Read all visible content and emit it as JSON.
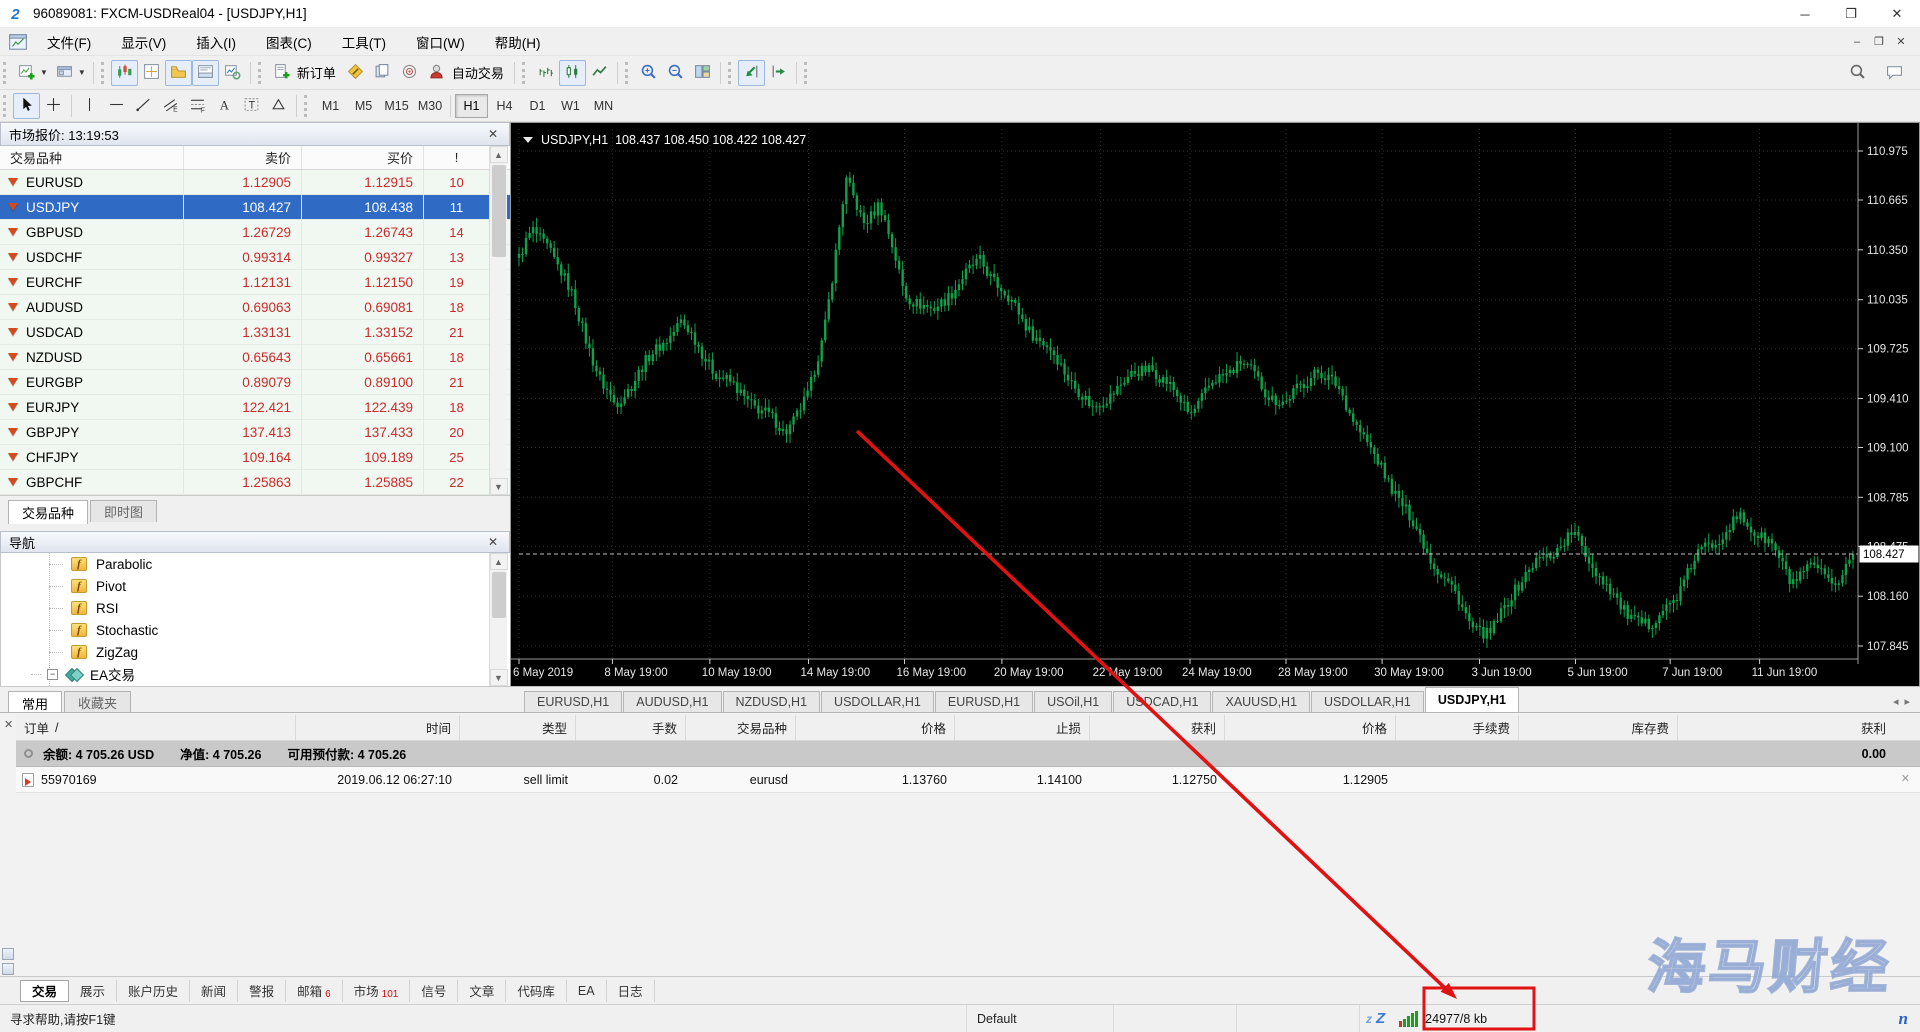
{
  "window": {
    "title": "96089081: FXCM-USDReal04 - [USDJPY,H1]"
  },
  "menu": {
    "items": [
      "文件(F)",
      "显示(V)",
      "插入(I)",
      "图表(C)",
      "工具(T)",
      "窗口(W)",
      "帮助(H)"
    ]
  },
  "toolbars": {
    "new_order_label": "新订单",
    "auto_trading_label": "自动交易",
    "main_groups": [
      [
        "new-chart",
        "profiles"
      ],
      [
        "market-watch",
        "data-window",
        "navigator",
        "terminal",
        "tester"
      ],
      [
        "new-order",
        "metaeditor",
        "docs",
        "optimization",
        "autotrading"
      ],
      [
        "bars-chart",
        "candles-chart",
        "line-chart"
      ],
      [
        "zoom-in",
        "zoom-out",
        "tile-windows"
      ],
      [
        "auto-scroll",
        "chart-shift"
      ]
    ],
    "right_icons": [
      "search",
      "chat"
    ],
    "pressed": [
      "market-watch",
      "navigator",
      "terminal",
      "candles-chart",
      "auto-scroll"
    ],
    "draw_icons": [
      "cursor",
      "crosshair",
      "sep",
      "vertical-line",
      "horizontal-line",
      "trendline",
      "channel",
      "fibonacci",
      "text",
      "label",
      "shapes"
    ],
    "timeframes": {
      "items": [
        "M1",
        "M5",
        "M15",
        "M30",
        "H1",
        "H4",
        "D1",
        "W1",
        "MN"
      ],
      "active": "H1"
    }
  },
  "market_watch": {
    "title": "市场报价: 13:19:53",
    "columns": [
      "交易品种",
      "卖价",
      "买价",
      "!"
    ],
    "rows": [
      [
        "EURUSD",
        "1.12905",
        "1.12915",
        "10"
      ],
      [
        "USDJPY",
        "108.427",
        "108.438",
        "11"
      ],
      [
        "GBPUSD",
        "1.26729",
        "1.26743",
        "14"
      ],
      [
        "USDCHF",
        "0.99314",
        "0.99327",
        "13"
      ],
      [
        "EURCHF",
        "1.12131",
        "1.12150",
        "19"
      ],
      [
        "AUDUSD",
        "0.69063",
        "0.69081",
        "18"
      ],
      [
        "USDCAD",
        "1.33131",
        "1.33152",
        "21"
      ],
      [
        "NZDUSD",
        "0.65643",
        "0.65661",
        "18"
      ],
      [
        "EURGBP",
        "0.89079",
        "0.89100",
        "21"
      ],
      [
        "EURJPY",
        "122.421",
        "122.439",
        "18"
      ],
      [
        "GBPJPY",
        "137.413",
        "137.433",
        "20"
      ],
      [
        "CHFJPY",
        "109.164",
        "109.189",
        "25"
      ],
      [
        "GBPCHF",
        "1.25863",
        "1.25885",
        "22"
      ]
    ],
    "selected_symbol": "USDJPY",
    "tabs": [
      "交易品种",
      "即时图"
    ],
    "active_tab": "交易品种"
  },
  "navigator": {
    "title": "导航",
    "items": [
      "Parabolic",
      "Pivot",
      "RSI",
      "Stochastic",
      "ZigZag",
      "EA交易"
    ],
    "tabs": [
      "常用",
      "收藏夹"
    ],
    "active_tab": "常用"
  },
  "chart_tabs": {
    "items": [
      "EURUSD,H1",
      "AUDUSD,H1",
      "NZDUSD,H1",
      "USDOLLAR,H1",
      "EURUSD,H1",
      "USOil,H1",
      "USDCAD,H1",
      "XAUUSD,H1",
      "USDOLLAR,H1",
      "USDJPY,H1"
    ],
    "active": "USDJPY,H1"
  },
  "chart_data": {
    "type": "candlestick",
    "symbol": "USDJPY",
    "timeframe": "H1",
    "legend": {
      "symbol": "USDJPY,H1",
      "open": "108.437",
      "high": "108.450",
      "low": "108.422",
      "close": "108.427"
    },
    "current_price": 108.427,
    "y_ticks": [
      110.975,
      110.665,
      110.35,
      110.035,
      109.725,
      109.41,
      109.1,
      108.785,
      108.475,
      108.16,
      107.845
    ],
    "ylim": [
      107.72,
      111.1
    ],
    "x_labels": [
      "6 May 2019",
      "8 May 19:00",
      "10 May 19:00",
      "14 May 19:00",
      "16 May 19:00",
      "20 May 19:00",
      "22 May 19:00",
      "24 May 19:00",
      "28 May 19:00",
      "30 May 19:00",
      "3 Jun 19:00",
      "5 Jun 19:00",
      "7 Jun 19:00",
      "11 Jun 19:00"
    ],
    "x_tick_fractions": [
      0.0,
      0.07,
      0.143,
      0.217,
      0.289,
      0.362,
      0.436,
      0.503,
      0.575,
      0.647,
      0.72,
      0.792,
      0.863,
      0.93
    ],
    "candle_count": 380,
    "price_path_anchors": [
      [
        0.0,
        110.3
      ],
      [
        0.01,
        110.46
      ],
      [
        0.022,
        110.38
      ],
      [
        0.04,
        110.05
      ],
      [
        0.062,
        109.5
      ],
      [
        0.072,
        109.36
      ],
      [
        0.09,
        109.58
      ],
      [
        0.121,
        109.9
      ],
      [
        0.15,
        109.55
      ],
      [
        0.17,
        109.42
      ],
      [
        0.199,
        109.2
      ],
      [
        0.217,
        109.42
      ],
      [
        0.228,
        109.8
      ],
      [
        0.245,
        110.78
      ],
      [
        0.258,
        110.52
      ],
      [
        0.27,
        110.65
      ],
      [
        0.289,
        110.08
      ],
      [
        0.31,
        109.95
      ],
      [
        0.33,
        110.15
      ],
      [
        0.346,
        110.28
      ],
      [
        0.362,
        110.1
      ],
      [
        0.38,
        109.88
      ],
      [
        0.399,
        109.7
      ],
      [
        0.42,
        109.46
      ],
      [
        0.43,
        109.33
      ],
      [
        0.45,
        109.5
      ],
      [
        0.474,
        109.62
      ],
      [
        0.503,
        109.32
      ],
      [
        0.52,
        109.5
      ],
      [
        0.541,
        109.65
      ],
      [
        0.56,
        109.45
      ],
      [
        0.575,
        109.38
      ],
      [
        0.598,
        109.6
      ],
      [
        0.616,
        109.45
      ],
      [
        0.64,
        109.05
      ],
      [
        0.655,
        108.85
      ],
      [
        0.684,
        108.4
      ],
      [
        0.703,
        108.15
      ],
      [
        0.714,
        107.98
      ],
      [
        0.728,
        107.9
      ],
      [
        0.745,
        108.2
      ],
      [
        0.762,
        108.36
      ],
      [
        0.79,
        108.55
      ],
      [
        0.81,
        108.3
      ],
      [
        0.826,
        108.08
      ],
      [
        0.848,
        107.96
      ],
      [
        0.87,
        108.2
      ],
      [
        0.886,
        108.45
      ],
      [
        0.916,
        108.65
      ],
      [
        0.937,
        108.5
      ],
      [
        0.953,
        108.26
      ],
      [
        0.97,
        108.34
      ],
      [
        0.985,
        108.22
      ],
      [
        1.0,
        108.43
      ]
    ],
    "grid": true,
    "legend_position": "top-left",
    "colors": {
      "background": "#000000",
      "grid": "#2e2e2e",
      "candle": "#0fa24a",
      "axis_text": "#e8e8e8",
      "price_tag_bg": "#ffffff",
      "price_tag_text": "#000000",
      "current_price_line": "#c0c0c0"
    }
  },
  "terminal": {
    "columns": [
      "订单",
      "时间",
      "类型",
      "手数",
      "交易品种",
      "价格",
      "止损",
      "获利",
      "价格",
      "手续费",
      "库存费",
      "获利"
    ],
    "sort_indicator": "/",
    "balance": {
      "items": [
        "余额: 4 705.26 USD",
        "净值: 4 705.26",
        "可用预付款: 4 705.26"
      ],
      "profit": "0.00"
    },
    "orders": [
      {
        "ticket": "55970169",
        "time": "2019.06.12 06:27:10",
        "type": "sell limit",
        "lots": "0.02",
        "symbol": "eurusd",
        "price": "1.13760",
        "sl": "1.14100",
        "tp": "1.12750",
        "current_price": "1.12905",
        "commission": "",
        "swap": "",
        "profit": ""
      }
    ],
    "tabs": [
      {
        "label": "交易",
        "badge": ""
      },
      {
        "label": "展示",
        "badge": ""
      },
      {
        "label": "账户历史",
        "badge": ""
      },
      {
        "label": "新闻",
        "badge": ""
      },
      {
        "label": "警报",
        "badge": ""
      },
      {
        "label": "邮箱",
        "badge": "6"
      },
      {
        "label": "市场",
        "badge": "101"
      },
      {
        "label": "信号",
        "badge": ""
      },
      {
        "label": "文章",
        "badge": ""
      },
      {
        "label": "代码库",
        "badge": ""
      },
      {
        "label": "EA",
        "badge": ""
      },
      {
        "label": "日志",
        "badge": ""
      }
    ],
    "active_tab": "交易"
  },
  "status_bar": {
    "help_text": "寻求帮助,请按F1键",
    "profile": "Default",
    "traffic": "24977/8 kb"
  },
  "watermark_text": "海马财经",
  "colors": {
    "selection": "#2f6bc4",
    "price_red": "#c92a2a",
    "annotation_red": "#e01212"
  }
}
